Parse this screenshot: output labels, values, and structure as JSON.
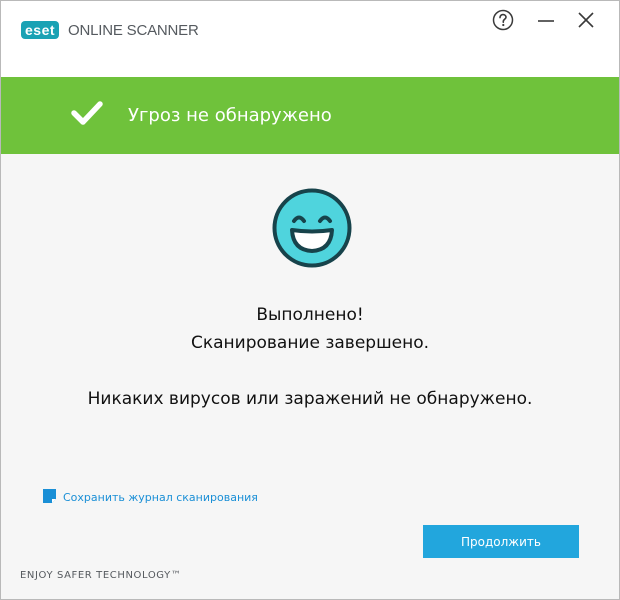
{
  "app": {
    "logo_text": "eset",
    "product_name": "ONLINE SCANNER"
  },
  "window_controls": {
    "help_icon": "question-circle-icon",
    "minimize_icon": "minimize-icon",
    "close_icon": "close-icon"
  },
  "banner": {
    "icon": "checkmark-icon",
    "text": "Угроз не обнаружено",
    "color": "#6fc23b"
  },
  "result": {
    "icon": "happy-face-icon",
    "line1": "Выполнено!",
    "line2": "Сканирование завершено.",
    "line3": "Никаких вирусов или заражений не обнаружено."
  },
  "actions": {
    "save_log_icon": "document-save-icon",
    "save_log_label": "Сохранить журнал сканирования",
    "continue_label": "Продолжить",
    "accent_color": "#22a6dd"
  },
  "footer": {
    "tagline": "ENJOY SAFER TECHNOLOGY™"
  }
}
